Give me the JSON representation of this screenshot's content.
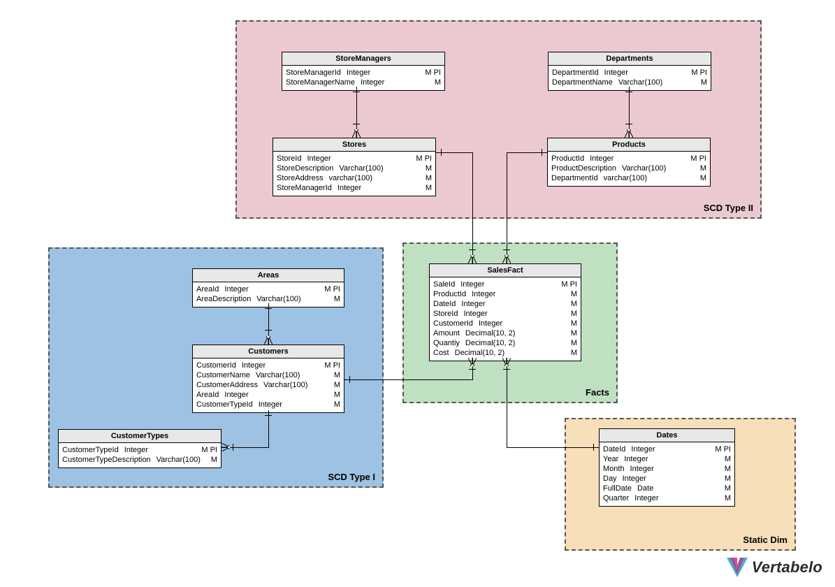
{
  "regions": {
    "scd2": {
      "label": "SCD Type II",
      "bg": "#ecc9d0"
    },
    "scd1": {
      "label": "SCD Type I",
      "bg": "#9ec2e3"
    },
    "facts": {
      "label": "Facts",
      "bg": "#c0e0c2"
    },
    "static": {
      "label": "Static Dim",
      "bg": "#f7dfb9"
    }
  },
  "entities": {
    "StoreManagers": {
      "title": "StoreManagers",
      "rows": [
        {
          "name": "StoreManagerId",
          "type": "Integer",
          "flags": "M PI"
        },
        {
          "name": "StoreManagerName",
          "type": "Integer",
          "flags": "M"
        }
      ]
    },
    "Stores": {
      "title": "Stores",
      "rows": [
        {
          "name": "StoreId",
          "type": "Integer",
          "flags": "M PI"
        },
        {
          "name": "StoreDescription",
          "type": "Varchar(100)",
          "flags": "M"
        },
        {
          "name": "StoreAddress",
          "type": "varchar(100)",
          "flags": "M"
        },
        {
          "name": "StoreManagerId",
          "type": "Integer",
          "flags": "M"
        }
      ]
    },
    "Departments": {
      "title": "Departments",
      "rows": [
        {
          "name": "DepartmentId",
          "type": "Integer",
          "flags": "M PI"
        },
        {
          "name": "DepartmentName",
          "type": "Varchar(100)",
          "flags": "M"
        }
      ]
    },
    "Products": {
      "title": "Products",
      "rows": [
        {
          "name": "ProductId",
          "type": "Integer",
          "flags": "M PI"
        },
        {
          "name": "ProductDescription",
          "type": "Varchar(100)",
          "flags": "M"
        },
        {
          "name": "DepartmentId",
          "type": "varchar(100)",
          "flags": "M"
        }
      ]
    },
    "Areas": {
      "title": "Areas",
      "rows": [
        {
          "name": "AreaId",
          "type": "Integer",
          "flags": "M PI"
        },
        {
          "name": "AreaDescription",
          "type": "Varchar(100)",
          "flags": "M"
        }
      ]
    },
    "Customers": {
      "title": "Customers",
      "rows": [
        {
          "name": "CustomerId",
          "type": "Integer",
          "flags": "M PI"
        },
        {
          "name": "CustomerName",
          "type": "Varchar(100)",
          "flags": "M"
        },
        {
          "name": "CustomerAddress",
          "type": "Varchar(100)",
          "flags": "M"
        },
        {
          "name": "AreaId",
          "type": "Integer",
          "flags": "M"
        },
        {
          "name": "CustomerTypeId",
          "type": "Integer",
          "flags": "M"
        }
      ]
    },
    "CustomerTypes": {
      "title": "CustomerTypes",
      "rows": [
        {
          "name": "CustomerTypeId",
          "type": "Integer",
          "flags": "M PI"
        },
        {
          "name": "CustomerTypeDescription",
          "type": "Varchar(100)",
          "flags": "M"
        }
      ]
    },
    "SalesFact": {
      "title": "SalesFact",
      "rows": [
        {
          "name": "SaleId",
          "type": "Integer",
          "flags": "M PI"
        },
        {
          "name": "ProductId",
          "type": "Integer",
          "flags": "M"
        },
        {
          "name": "DateId",
          "type": "Integer",
          "flags": "M"
        },
        {
          "name": "StoreId",
          "type": "Integer",
          "flags": "M"
        },
        {
          "name": "CustomerId",
          "type": "Integer",
          "flags": "M"
        },
        {
          "name": "Amount",
          "type": "Decimal(10, 2)",
          "flags": "M"
        },
        {
          "name": "Quantiy",
          "type": "Decimal(10, 2)",
          "flags": "M"
        },
        {
          "name": "Cost",
          "type": "Decimal(10, 2)",
          "flags": "M"
        }
      ]
    },
    "Dates": {
      "title": "Dates",
      "rows": [
        {
          "name": "DateId",
          "type": "Integer",
          "flags": "M PI"
        },
        {
          "name": "Year",
          "type": "Integer",
          "flags": "M"
        },
        {
          "name": "Month",
          "type": "Integer",
          "flags": "M"
        },
        {
          "name": "Day",
          "type": "Integer",
          "flags": "M"
        },
        {
          "name": "FullDate",
          "type": "Date",
          "flags": "M"
        },
        {
          "name": "Quarter",
          "type": "Integer",
          "flags": "M"
        }
      ]
    }
  },
  "logo": {
    "text": "Vertabelo"
  },
  "relationships": [
    {
      "from": "StoreManagers",
      "to": "Stores",
      "type": "one-to-many"
    },
    {
      "from": "Departments",
      "to": "Products",
      "type": "one-to-many"
    },
    {
      "from": "Areas",
      "to": "Customers",
      "type": "one-to-many"
    },
    {
      "from": "CustomerTypes",
      "to": "Customers",
      "type": "one-to-many"
    },
    {
      "from": "Stores",
      "to": "SalesFact",
      "type": "one-to-many"
    },
    {
      "from": "Products",
      "to": "SalesFact",
      "type": "one-to-many"
    },
    {
      "from": "Customers",
      "to": "SalesFact",
      "type": "one-to-many"
    },
    {
      "from": "Dates",
      "to": "SalesFact",
      "type": "one-to-many"
    }
  ]
}
